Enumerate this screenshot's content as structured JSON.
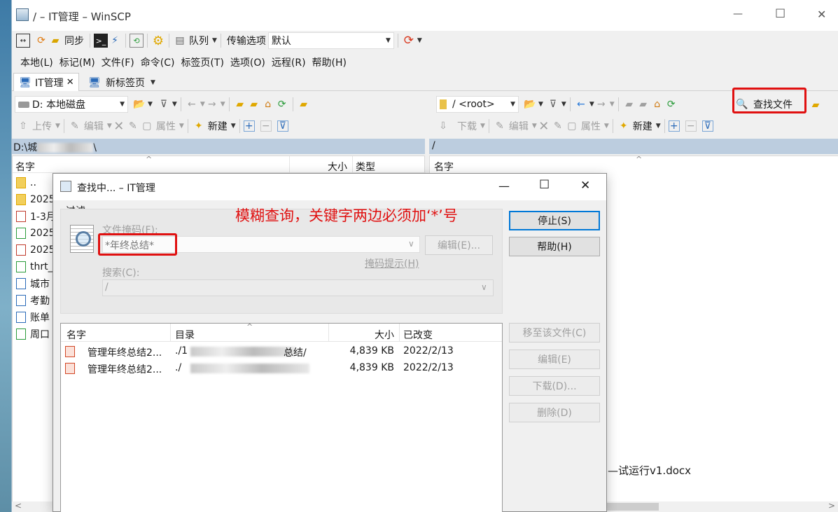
{
  "window": {
    "title": "/ – IT管理 – WinSCP",
    "minimize": "—",
    "maximize": "☐",
    "close": "✕"
  },
  "toolbar1": {
    "sync": "同步",
    "queue": "队列",
    "transfer_label": "传输选项",
    "transfer_value": "默认"
  },
  "menu": [
    "本地(L)",
    "标记(M)",
    "文件(F)",
    "命令(C)",
    "标签页(T)",
    "选项(O)",
    "远程(R)",
    "帮助(H)"
  ],
  "tabs": {
    "active": "IT管理",
    "new_tab": "新标签页"
  },
  "local": {
    "drive": "D: 本地磁盘",
    "upload": "上传",
    "edit": "编辑",
    "properties": "属性",
    "new": "新建",
    "path": "D:\\城",
    "path_end": "\\",
    "columns": [
      "名字",
      "大小",
      "类型"
    ],
    "files": [
      "..",
      "2025",
      "1-3月",
      "2025",
      "2025",
      "thrt_",
      "城市",
      "考勤",
      "账单",
      "周口"
    ]
  },
  "remote": {
    "path_combo": "/ <root>",
    "find_files": "查找文件",
    "download": "下载",
    "edit": "编辑",
    "properties": "属性",
    "new": "新建",
    "path": "/",
    "columns": [
      "名字"
    ],
    "visible_file": "试运行v1.docx"
  },
  "dialog": {
    "title": "查找中... – IT管理",
    "filter_group": "过滤",
    "mask_label": "文件掩码(F):",
    "mask_value": "*年终总结*",
    "edit_button": "编辑(E)...",
    "mask_hint": "掩码提示(H)",
    "search_label": "搜索(C):",
    "search_value": "/",
    "stop_button": "停止(S)",
    "help_button": "帮助(H)",
    "columns": [
      "名字",
      "目录",
      "大小",
      "已改变"
    ],
    "results": [
      {
        "name": "管理年终总结2...",
        "dir": "./1",
        "dir_end": "总结/",
        "size": "4,839 KB",
        "changed": "2022/2/13"
      },
      {
        "name": "管理年终总结2...",
        "dir": "./",
        "dir_end": "",
        "size": "4,839 KB",
        "changed": "2022/2/13"
      }
    ],
    "goto_button": "移至该文件(C)",
    "edit_result_button": "编辑(E)",
    "download_button": "下载(D)...",
    "delete_button": "删除(D)"
  },
  "annotation": {
    "text": "模糊查询，关键字两边必须加‘*’号",
    "color": "#e01010"
  },
  "colors": {
    "highlight_box": "#e01010",
    "accent": "#0078d7"
  }
}
